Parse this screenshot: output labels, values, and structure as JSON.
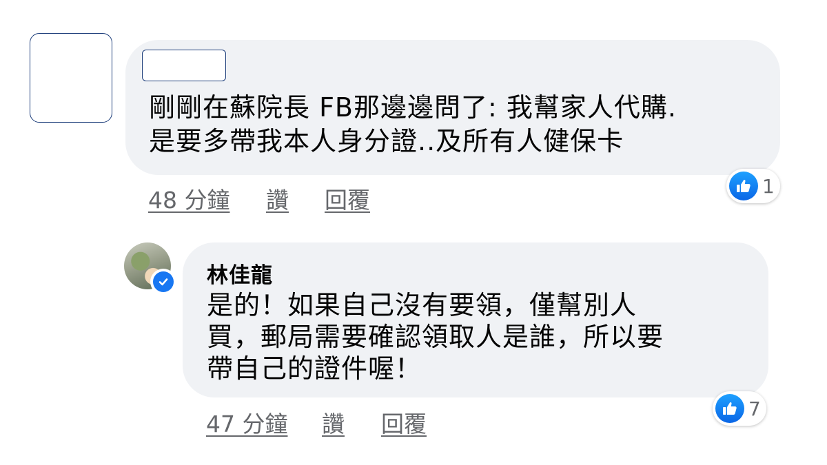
{
  "comment": {
    "body": "剛剛在蘇院長 FB那邊邊問了: 我幫家人代購.\n是要多帶我本人身分證..及所有人健保卡",
    "time": "48 分鐘",
    "like_label": "讚",
    "reply_label": "回覆",
    "reaction": {
      "icon": "thumbs-up-icon",
      "count": "1"
    }
  },
  "reply": {
    "author": "林佳龍",
    "verified": true,
    "body": "是的！如果自己沒有要領，僅幫別人\n買，郵局需要確認領取人是誰，所以要\n帶自己的證件喔！",
    "time": "47 分鐘",
    "like_label": "讚",
    "reply_label": "回覆",
    "reaction": {
      "icon": "thumbs-up-icon",
      "count": "7"
    }
  },
  "colors": {
    "bubble": "#f0f2f5",
    "meta_text": "#65676b",
    "like_blue": "#1877f2",
    "redaction_border": "#1c3d7a"
  }
}
